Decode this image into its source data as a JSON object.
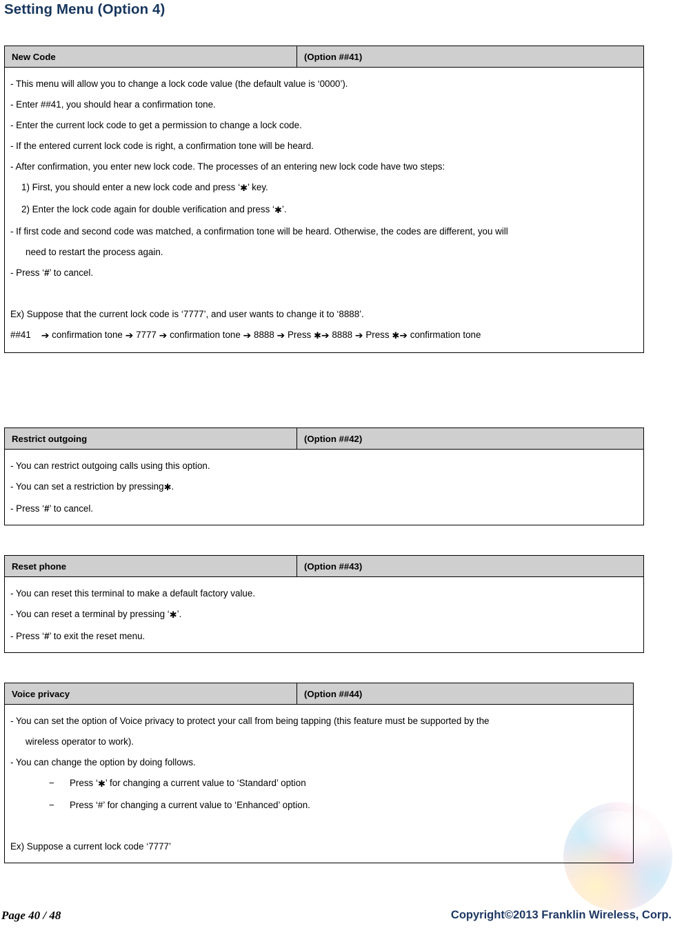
{
  "title": "Setting Menu (Option 4)",
  "colors": {
    "title_blue": "#17365D",
    "header_gray": "#CFCFCF",
    "copyright_blue": "#1F3864",
    "border_black": "#000000"
  },
  "symbols": {
    "star": "✱",
    "hash": "#",
    "arrow": "➔",
    "dash": "−"
  },
  "tables": [
    {
      "name": "New Code",
      "option": "(Option ##41)",
      "lines": [
        "- This menu will allow you to change a lock code value (the default value is ‘0000’).",
        "- Enter ##41, you should hear a confirmation tone.",
        "- Enter the current lock code to get a permission to change a lock code.",
        "- If the entered current lock code is right, a confirmation tone will be heard.",
        "- After confirmation, you enter new lock code. The processes of an entering new lock code have two steps:",
        "1) First, you should enter a new lock code and press ‘✱’ key.",
        "2) Enter the lock code again for double verification and press ‘✱’.",
        "- If first code and second code was matched, a confirmation tone will be heard. Otherwise, the codes are different, you will need to restart the process again.",
        "- Press ‘#’ to cancel.",
        "Ex) Suppose that the current lock code is ‘7777’, and user wants to change it to ‘8888’.",
        "##41 ➔ confirmation tone ➔ 7777 ➔ confirmation tone ➔ 8888 ➔ Press ✱➔ 8888 ➔ Press ✱➔ confirmation tone"
      ],
      "line1": "- This menu will allow you to change a lock code value (the default value is ‘0000’).",
      "line2": "- Enter ##41, you should hear a confirmation tone.",
      "line3": "- Enter the current lock code to get a permission to change a lock code.",
      "line4": "- If the entered current lock code is right, a confirmation tone will be heard.",
      "line5": "- After confirmation, you enter new lock code. The processes of an entering new lock code have two steps:",
      "step1_a": "1) First, you should enter a new lock code and press ‘",
      "step1_b": "’ key.",
      "step2_a": "2) Enter the lock code again for double verification and press ‘",
      "step2_b": "’.",
      "line6": "- If first code and second code was matched, a confirmation tone will be heard. Otherwise, the codes are different, you will",
      "line6b": "need to restart the process again.",
      "cancel_a": "- Press ‘",
      "cancel_b": "#",
      "cancel_c": "’ to cancel.",
      "ex_intro": "Ex) Suppose that the current lock code is ‘7777’, and user wants to change it to ‘8888’.",
      "flow": {
        "start": "##41",
        "t1": "confirmation tone",
        "t2": "7777",
        "t3": "confirmation tone",
        "t4": "8888",
        "t5": "Press",
        "t6": "8888",
        "t7": "Press",
        "t8": "confirmation tone"
      }
    },
    {
      "name": "Restrict outgoing",
      "option": "(Option ##42)",
      "line1": "- You can restrict outgoing calls using this option.",
      "line2_a": "- You can set a restriction by pressing",
      "line2_b": ".",
      "line3_a": "- Press ‘",
      "line3_b": "#",
      "line3_c": "’ to cancel."
    },
    {
      "name": "Reset phone",
      "option": "(Option ##43)",
      "line1": "- You can reset this terminal to make a default factory value.",
      "line2_a": "- You can reset a terminal by pressing ‘",
      "line2_b": "’.",
      "line3_a": "- Press ‘",
      "line3_b": "#",
      "line3_c": "’ to exit the reset menu."
    },
    {
      "name": "Voice privacy",
      "option": "(Option ##44)",
      "line1": "- You can set the option of Voice privacy to protect your call from being tapping (this feature must be supported by the",
      "line1b": "wireless operator to work).",
      "line2": "- You can change the option by doing follows.",
      "bullet1_a": "Press ‘",
      "bullet1_b": "’ for changing a current value to ‘Standard’ option",
      "bullet2_a": "Press ‘#’ for changing a current value to ‘Enhanced’ option.",
      "ex_line": "Ex) Suppose a current lock code ‘7777’"
    }
  ],
  "footer": {
    "page": "Page  40  /  48",
    "copyright": "Copyright©2013  Franklin  Wireless, Corp."
  }
}
